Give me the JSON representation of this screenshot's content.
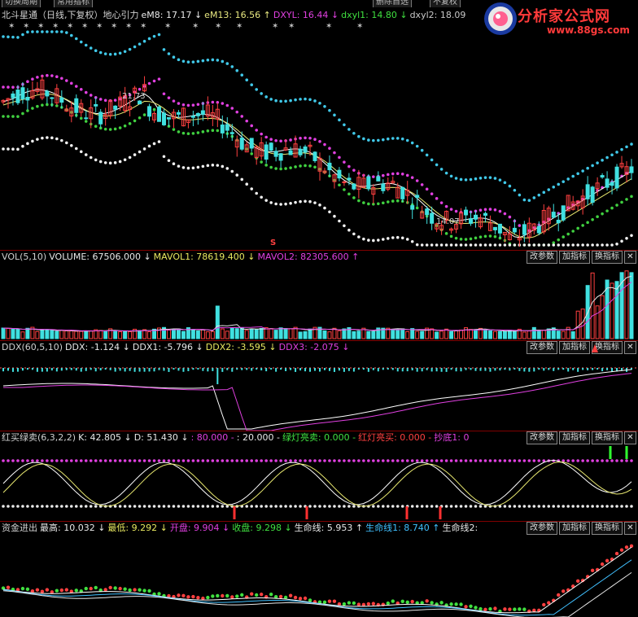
{
  "toolbar": {
    "switch_period": "切换周期",
    "common_indicators": "常用指标",
    "delete_selfselect": "删除自选",
    "no_restore": "不复权"
  },
  "logo": {
    "name": "分析家公式网",
    "url": "www.88gs.com"
  },
  "main_panel": {
    "legend": [
      {
        "text": "北斗星通（日线,下复权）地心引力",
        "color": "#d0d0d0"
      },
      {
        "text": "eM8: 17.17 ↓",
        "color": "#e8e8e8"
      },
      {
        "text": "eM13: 16.56 ↑",
        "color": "#e8e880"
      },
      {
        "text": "DXYL: 16.44 ↓",
        "color": "#e040e0"
      },
      {
        "text": "dxyl1: 14.80 ↓",
        "color": "#40e040"
      },
      {
        "text": "dxyl2: 18.09",
        "color": "#c8c8c8"
      }
    ],
    "high_label": "21.73",
    "low_label": "14.07",
    "marker": "S"
  },
  "vol_panel": {
    "legend": [
      {
        "text": "VOL(5,10)",
        "color": "#d0d0d0"
      },
      {
        "text": "VOLUME: 67506.000 ↓",
        "color": "#e8e8e8"
      },
      {
        "text": "MAVOL1: 78619.400 ↓",
        "color": "#e8e860"
      },
      {
        "text": "MAVOL2: 82305.600 ↑",
        "color": "#e040e0"
      }
    ]
  },
  "ddx_panel": {
    "legend": [
      {
        "text": "DDX(60,5,10)",
        "color": "#d0d0d0"
      },
      {
        "text": "DDX: -1.124 ↓",
        "color": "#e8e8e8"
      },
      {
        "text": "DDX1: -5.796 ↓",
        "color": "#e8e8e8"
      },
      {
        "text": "DDX2: -3.595 ↓",
        "color": "#e8e860"
      },
      {
        "text": "DDX3: -2.075 ↓",
        "color": "#e040e0"
      }
    ]
  },
  "kd_panel": {
    "legend": [
      {
        "text": "红买绿卖(6,3,2,2)",
        "color": "#d0d0d0"
      },
      {
        "text": "K: 42.805 ↓",
        "color": "#e8e8e8"
      },
      {
        "text": "D: 51.430 ↓",
        "color": "#e8e8e8"
      },
      {
        "text": ": 80.000 -",
        "color": "#e040e0"
      },
      {
        "text": ": 20.000 -",
        "color": "#e8e8e8"
      },
      {
        "text": "绿灯亮卖: 0.000 -",
        "color": "#40e040"
      },
      {
        "text": "红灯亮买: 0.000 -",
        "color": "#ff4040"
      },
      {
        "text": "抄底1: 0",
        "color": "#e040e0"
      }
    ]
  },
  "money_panel": {
    "legend": [
      {
        "text": "资金进出",
        "color": "#d0d0d0"
      },
      {
        "text": "最高: 10.032 ↓",
        "color": "#e8e8e8"
      },
      {
        "text": "最低: 9.292 ↓",
        "color": "#e8e860"
      },
      {
        "text": "开盘: 9.904 ↓",
        "color": "#e040e0"
      },
      {
        "text": "收盘: 9.298 ↓",
        "color": "#40e040"
      },
      {
        "text": "生命线: 5.953 ↑",
        "color": "#e8e8e8"
      },
      {
        "text": "生命线1: 8.740 ↑",
        "color": "#40c0ff"
      },
      {
        "text": "生命线2:",
        "color": "#e8e8e8"
      }
    ]
  },
  "panel_buttons": {
    "modify": "改参数",
    "add": "加指标",
    "switch": "换指标",
    "close": "✕"
  },
  "colors": {
    "up": "#ff4040",
    "down": "#40e0e0",
    "border": "#800000",
    "magenta": "#e040e0",
    "green": "#40e040"
  }
}
